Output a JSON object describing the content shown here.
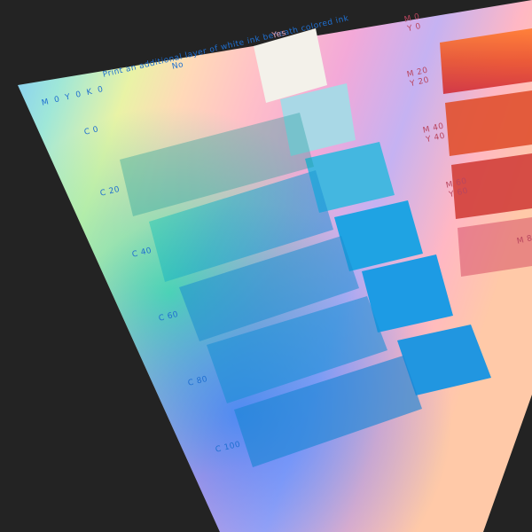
{
  "header": {
    "question": "Print an additional layer of white ink beneath colored ink",
    "no_label": "No",
    "yes_label": "Yes",
    "base_label": "M 0 Y 0 K 0"
  },
  "rows": [
    {
      "label": "C 0"
    },
    {
      "label": "C 20"
    },
    {
      "label": "C 40"
    },
    {
      "label": "C 60"
    },
    {
      "label": "C 80"
    },
    {
      "label": "C 100"
    }
  ],
  "right_labels": [
    {
      "line1": "M 0",
      "line2": "Y 0"
    },
    {
      "line1": "M 20",
      "line2": "Y 20"
    },
    {
      "line1": "M 40",
      "line2": "Y 40"
    },
    {
      "line1": "M 60",
      "line2": "Y 60"
    },
    {
      "line1": "M 8",
      "line2": ""
    }
  ],
  "colors": {
    "background": "#232323",
    "label_blue": "#1f6fd0",
    "label_pink": "#b8455e",
    "white_patch": "#f3f1ea"
  }
}
